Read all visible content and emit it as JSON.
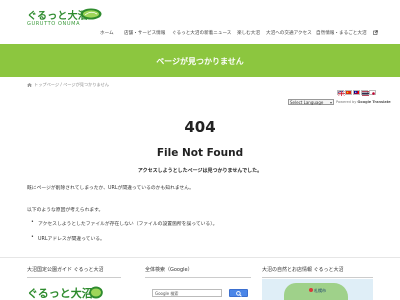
{
  "header": {
    "logo_text": "ぐるっと大沼",
    "logo_sub": "GURUTTO ONUMA",
    "nav": [
      {
        "label": "ホーム"
      },
      {
        "label": "店舗・サービス情報"
      },
      {
        "label": "ぐるっと大沼の新着ニュース"
      },
      {
        "label": "楽しむ大沼"
      },
      {
        "label": "大沼への交通アクセス"
      },
      {
        "label": "自然情報・まるごと大沼"
      }
    ],
    "external_icon": "external-link-icon"
  },
  "banner": {
    "title": "ページが見つかりません"
  },
  "breadcrumb": {
    "text": "トップページ / ページが見つかりません",
    "icon": "home-icon"
  },
  "translate": {
    "select_label": "Select Language",
    "powered_prefix": "Powered by",
    "powered_brand": "Google Translate",
    "flags": [
      "flag-uk",
      "flag-china",
      "flag-taiwan",
      "flag-thailand",
      "flag-japan"
    ]
  },
  "error": {
    "code": "404",
    "title": "File Not Found",
    "message": "アクセスしようとしたページは見つかりませんでした。",
    "detail": "既にページが削除されてしまったか、URLが間違っているのかも知れません。",
    "reasons_intro": "以下のような原因が考えられます。",
    "reasons": [
      "アクセスしようとしたファイルが存在しない（ファイルの設置箇所を誤っている）。",
      "URLアドレスが間違っている。"
    ]
  },
  "footer": {
    "col1_title": "大沼国定公園ガイド ぐるっと大沼",
    "col1_logo": "ぐるっと大沼",
    "col2_title": "全体検索（Google）",
    "search_placeholder": "Google 検索",
    "col3_title": "大沼の自然とお店情報 ぐるっと大沼",
    "map_label": "札幌市"
  },
  "colors": {
    "brand_green": "#8cc63f",
    "logo_green": "#2e8b2e",
    "search_blue": "#4a86e8"
  }
}
